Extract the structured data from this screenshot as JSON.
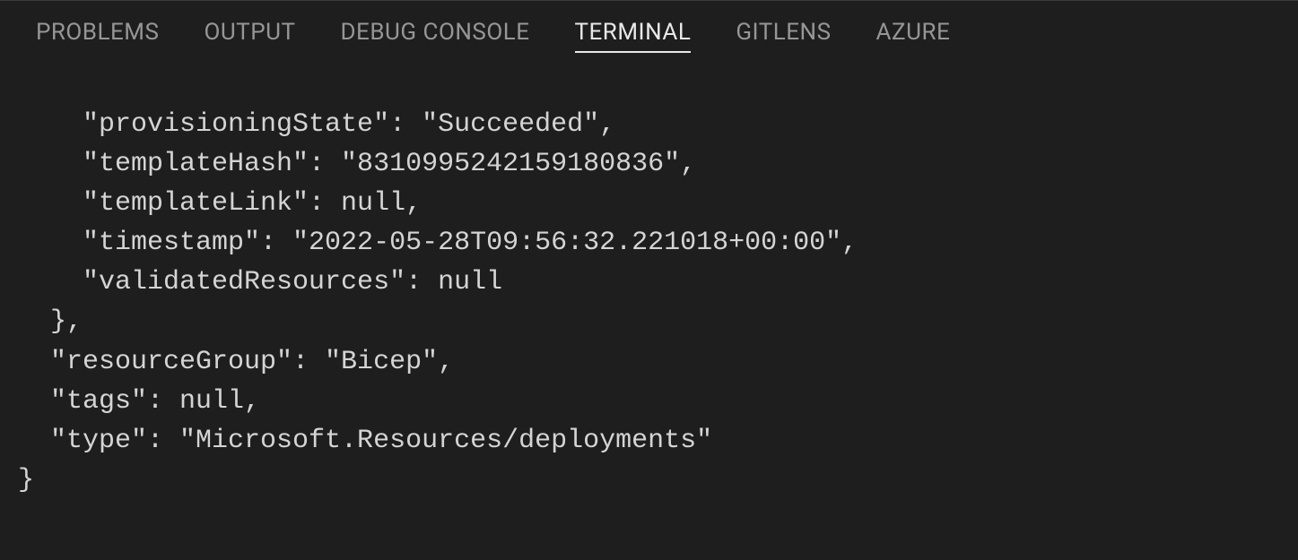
{
  "tabs": [
    {
      "label": "PROBLEMS",
      "active": false
    },
    {
      "label": "OUTPUT",
      "active": false
    },
    {
      "label": "DEBUG CONSOLE",
      "active": false
    },
    {
      "label": "TERMINAL",
      "active": true
    },
    {
      "label": "GITLENS",
      "active": false
    },
    {
      "label": "AZURE",
      "active": false
    }
  ],
  "terminal": {
    "lines": [
      "    \"provisioningState\": \"Succeeded\",",
      "    \"templateHash\": \"8310995242159180836\",",
      "    \"templateLink\": null,",
      "    \"timestamp\": \"2022-05-28T09:56:32.221018+00:00\",",
      "    \"validatedResources\": null",
      "  },",
      "  \"resourceGroup\": \"Bicep\",",
      "  \"tags\": null,",
      "  \"type\": \"Microsoft.Resources/deployments\"",
      "}"
    ]
  }
}
